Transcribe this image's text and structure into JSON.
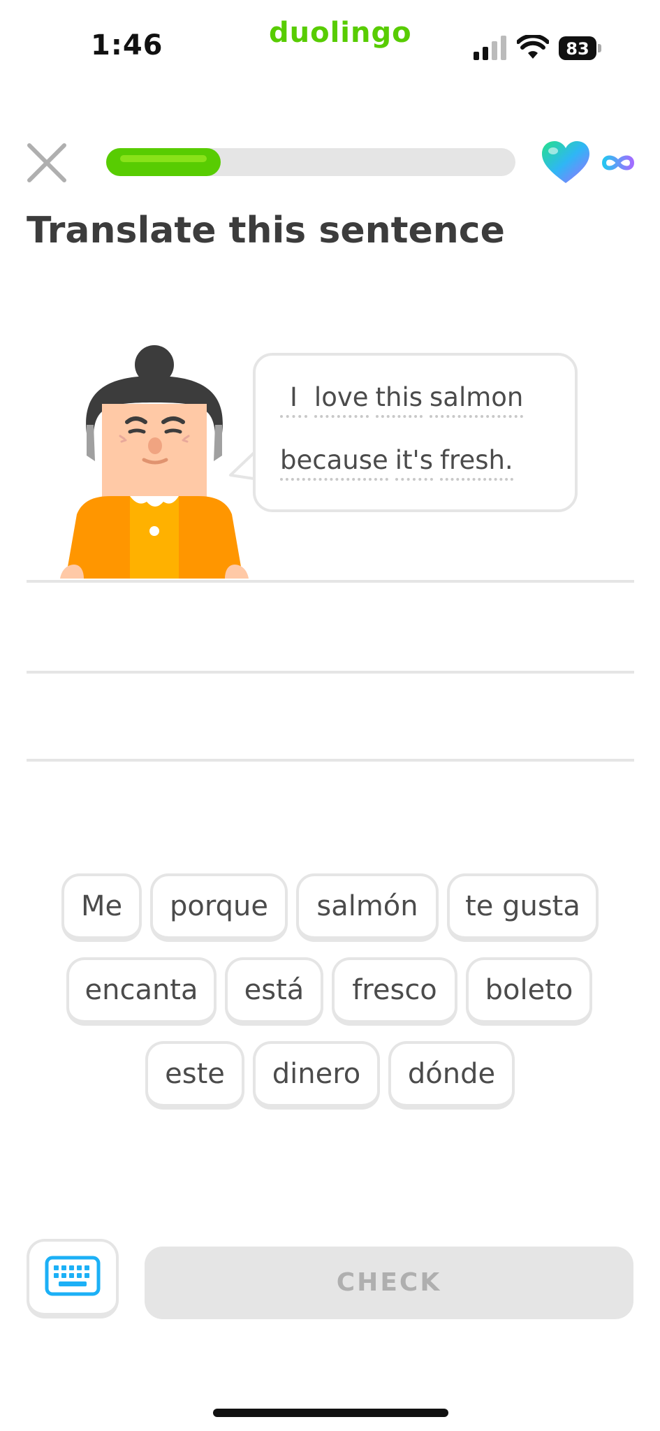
{
  "status_bar": {
    "time": "1:46",
    "brand": "duolingo",
    "battery": "83"
  },
  "header": {
    "progress_percent": 28
  },
  "prompt": {
    "title": "Translate this sentence"
  },
  "sentence": {
    "line1": [
      "I",
      "love",
      "this",
      "salmon"
    ],
    "line2": [
      "because",
      "it's",
      "fresh."
    ]
  },
  "word_bank": [
    "Me",
    "porque",
    "salmón",
    "te gusta",
    "encanta",
    "está",
    "fresco",
    "boleto",
    "este",
    "dinero",
    "dónde"
  ],
  "footer": {
    "check_label": "CHECK"
  },
  "colors": {
    "accent": "#58cc02",
    "chip_border": "#e5e5e5",
    "keyboard_icon": "#1cb0f6"
  }
}
